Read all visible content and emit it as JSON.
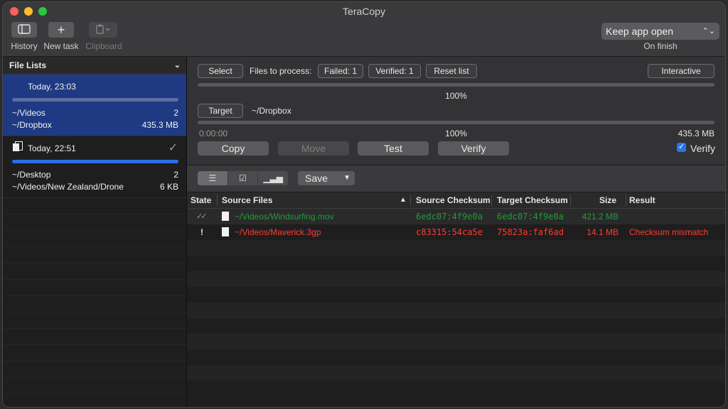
{
  "window": {
    "title": "TeraCopy"
  },
  "toolbar": {
    "history_label": "History",
    "new_task_label": "New task",
    "clipboard_label": "Clipboard",
    "keep_app": "Keep app open",
    "on_finish": "On finish"
  },
  "sidebar": {
    "header": "File Lists",
    "entries": [
      {
        "time": "Today, 23:03",
        "source": "~/Videos",
        "source_count": "2",
        "target": "~/Dropbox",
        "target_size": "435.3 MB"
      },
      {
        "time": "Today, 22:51",
        "source": "~/Desktop",
        "source_count": "2",
        "target": "~/Videos/New Zealand/Drone",
        "target_size": "6 KB"
      }
    ]
  },
  "controls": {
    "select": "Select",
    "files_to_process": "Files to process:",
    "failed": "Failed: 1",
    "verified": "Verified: 1",
    "reset": "Reset list",
    "interactive": "Interactive",
    "progress1_pct": "100%",
    "target_btn": "Target",
    "target_path": "~/Dropbox",
    "elapsed": "0:00:00",
    "progress2_pct": "100%",
    "total_size": "435.3 MB",
    "copy": "Copy",
    "move": "Move",
    "test": "Test",
    "verify": "Verify",
    "verify_check_label": "Verify"
  },
  "list_toolbar": {
    "save": "Save"
  },
  "table": {
    "columns": [
      "State",
      "Source Files",
      "Source Checksum",
      "Target Checksum",
      "Size",
      "Result"
    ],
    "rows": [
      {
        "state": "✓✓",
        "file": "~/Videos/Windsurfing.mov",
        "src_checksum": "6edc07:4f9e0a",
        "tgt_checksum": "6edc07:4f9e0a",
        "size": "421.2 MB",
        "result": ""
      },
      {
        "state": "!",
        "file": "~/Videos/Maverick.3gp",
        "src_checksum": "c83315:54ca5e",
        "tgt_checksum": "75823a:faf6ad",
        "size": "14.1 MB",
        "result": "Checksum mismatch"
      }
    ]
  },
  "colors": {
    "selection": "#1f3a82",
    "ok": "#1f9d3a",
    "error": "#ff3b30",
    "accent": "#2c73e8"
  }
}
